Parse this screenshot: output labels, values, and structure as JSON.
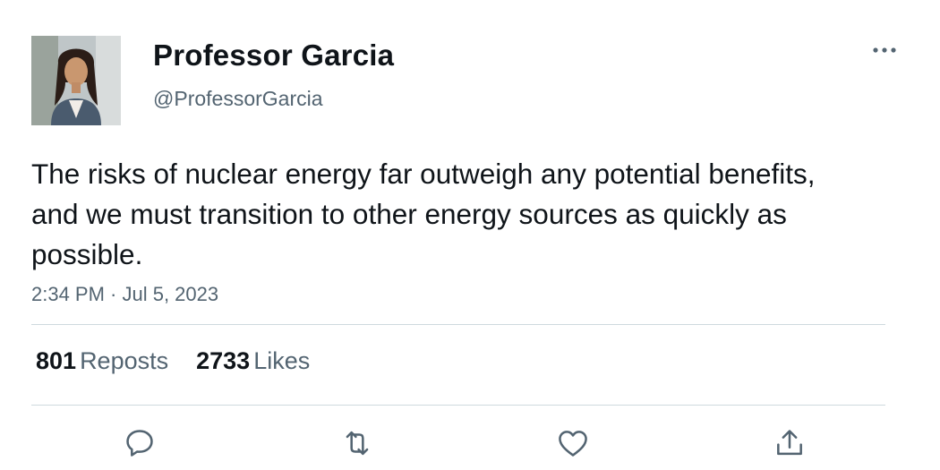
{
  "tweet": {
    "author_name": "Professor Garcia",
    "author_handle": "@ProfessorGarcia",
    "text": "The risks of nuclear energy far outweigh any potential benefits, and we must transition to other energy sources as quickly as possible.",
    "timestamp": "2:34 PM · Jul 5, 2023"
  },
  "stats": {
    "reposts_count": "801",
    "reposts_label": "Reposts",
    "likes_count": "2733",
    "likes_label": "Likes"
  },
  "icons": {
    "more": "more-horizontal-icon",
    "reply": "reply-icon",
    "repost": "repost-icon",
    "like": "heart-icon",
    "share": "share-icon"
  },
  "colors": {
    "text_primary": "#0f1419",
    "text_secondary": "#536471",
    "divider": "#cfd9de"
  }
}
